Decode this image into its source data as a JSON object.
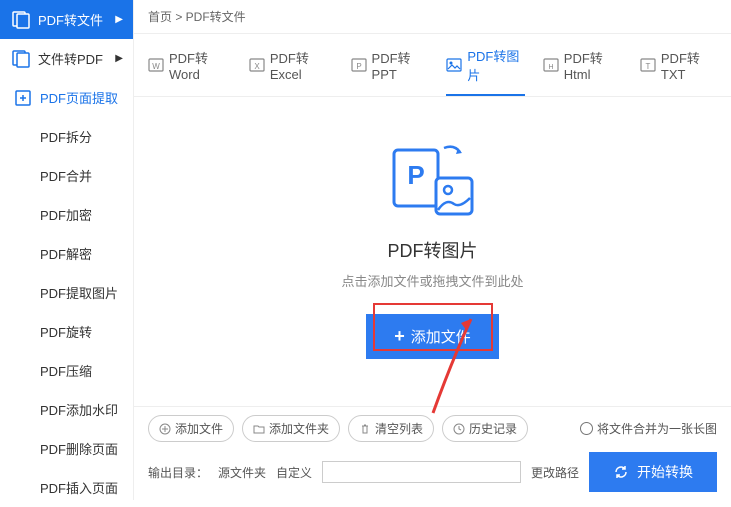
{
  "breadcrumb": "首页 > PDF转文件",
  "sidebar": {
    "items": [
      {
        "label": "PDF转文件",
        "arrow": "▶"
      },
      {
        "label": "文件转PDF",
        "arrow": "▶"
      },
      {
        "label": "PDF页面提取"
      },
      {
        "label": "PDF拆分"
      },
      {
        "label": "PDF合并"
      },
      {
        "label": "PDF加密"
      },
      {
        "label": "PDF解密"
      },
      {
        "label": "PDF提取图片"
      },
      {
        "label": "PDF旋转"
      },
      {
        "label": "PDF压缩"
      },
      {
        "label": "PDF添加水印"
      },
      {
        "label": "PDF删除页面"
      },
      {
        "label": "PDF插入页面"
      }
    ]
  },
  "tabs": [
    {
      "label": "PDF转Word"
    },
    {
      "label": "PDF转Excel"
    },
    {
      "label": "PDF转PPT"
    },
    {
      "label": "PDF转图片"
    },
    {
      "label": "PDF转Html"
    },
    {
      "label": "PDF转TXT"
    }
  ],
  "drop": {
    "title": "PDF转图片",
    "sub": "点击添加文件或拖拽文件到此处",
    "button": "添加文件"
  },
  "footer": {
    "btns": [
      "添加文件",
      "添加文件夹",
      "清空列表",
      "历史记录"
    ],
    "merge": "将文件合并为一张长图",
    "outlabel": "输出目录：",
    "src": "源文件夹",
    "custom": "自定义",
    "changepath": "更改路径",
    "convert": "开始转换"
  }
}
